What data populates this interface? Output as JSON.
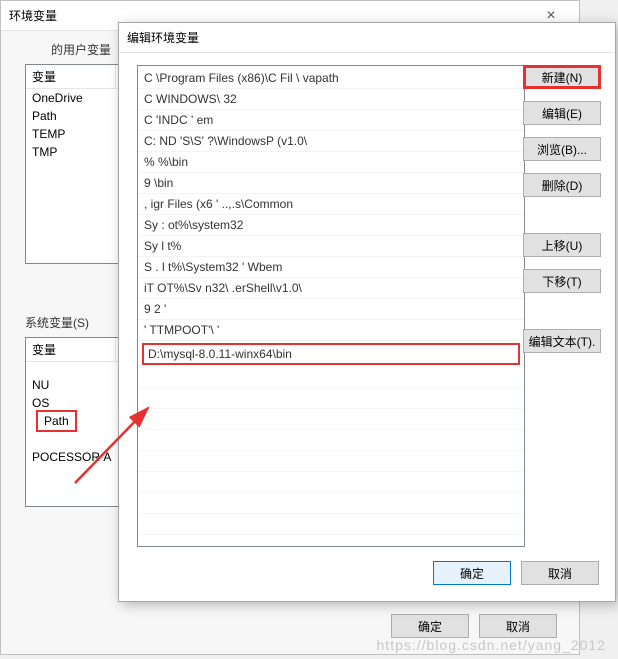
{
  "back_dialog": {
    "title": "环境变量",
    "close_glyph": "×",
    "user_group_label": "的用户变量",
    "col_var": "变量",
    "user_vars": [
      "OneDrive",
      "Path",
      "TEMP",
      "TMP"
    ],
    "sys_group_label": "系统变量(S)",
    "sys_vars_visible": [
      "NU",
      "OS",
      "Path",
      " ",
      "POCESSOR A"
    ],
    "ok": "确定",
    "cancel": "取消"
  },
  "front_dialog": {
    "title": "编辑环境变量",
    "paths": [
      "C  \\Program Files (x86)\\C            Fil                   \\  vapath",
      "C  WINDOWS\\              32",
      "C       'INDC   '                          em",
      "C:      ND    'S\\S'        ?\\WindowsP             (v1.0\\",
      "%                 %\\bin",
      "9                        \\bin",
      "    ,  igr    Files (x6            '            ..,.s\\Common",
      "  Sy :    ot%\\system32",
      "Sy       l       t%",
      "S .     l     t%\\System32 '  Wbem",
      "     iT        OT%\\Sv       n32\\                 .erShell\\v1.0\\",
      "9      2   '",
      "'    TTMPOOT'\\  '"
    ],
    "highlighted_path": "D:\\mysql-8.0.11-winx64\\bin",
    "buttons": {
      "new_": "新建(N)",
      "edit": "编辑(E)",
      "browse": "浏览(B)...",
      "delete": "删除(D)",
      "up": "上移(U)",
      "down": "下移(T)",
      "edit_text": "编辑文本(T)."
    },
    "ok": "确定",
    "cancel": "取消"
  },
  "watermark": "https://blog.csdn.net/yang_2012"
}
